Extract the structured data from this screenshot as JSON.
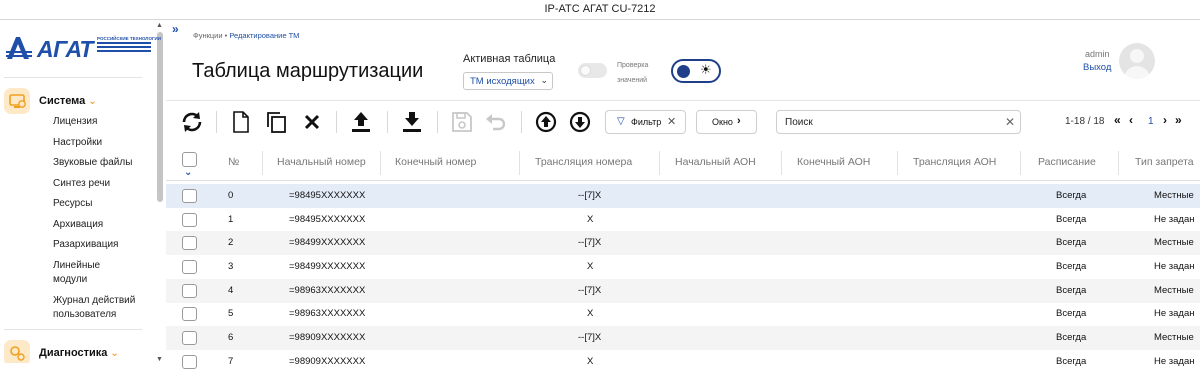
{
  "app_title": "IP-АТС АГАТ CU-7212",
  "logo": {
    "word": "АГАТ",
    "sub": "РОССИЙСКИЕ ТЕХНОЛОГИИ"
  },
  "sidebar": {
    "sections": [
      {
        "title": "Система",
        "items": [
          "Лицензия",
          "Настройки",
          "Звуковые файлы",
          "Синтез речи",
          "Ресурсы",
          "Архивация",
          "Разархивация",
          "Линейные модули",
          "Журнал действий пользователя"
        ]
      },
      {
        "title": "Диагностика",
        "items": []
      }
    ]
  },
  "breadcrumb": {
    "parent": "Функции",
    "current": "Редактирование ТМ"
  },
  "page_title": "Таблица маршрутизации",
  "active_table": {
    "label": "Активная таблица",
    "value": "ТМ исходящих"
  },
  "value_check": {
    "label_line1": "Проверка",
    "label_line2": "значений",
    "enabled": false
  },
  "user": {
    "name": "admin",
    "logout": "Выход"
  },
  "toolbar": {
    "icons": [
      "refresh-icon",
      "new-file-icon",
      "copy-icon",
      "delete-icon",
      "upload-icon",
      "download-icon",
      "save-icon",
      "undo-icon",
      "move-up-icon",
      "move-down-icon"
    ],
    "filter_label": "Фильтр",
    "window_label": "Окно",
    "search_placeholder": "Поиск"
  },
  "pager": {
    "range": "1-18 / 18",
    "page": "1"
  },
  "table": {
    "columns": [
      "№",
      "Начальный номер",
      "Конечный номер",
      "Трансляция номера",
      "Начальный АОН",
      "Конечный АОН",
      "Трансляция АОН",
      "Расписание",
      "Тип запрета"
    ],
    "rows": [
      {
        "n": "0",
        "start": "=98495XXXXXXX",
        "end": "",
        "trans": "--[7]X",
        "aon_start": "",
        "aon_end": "",
        "aon_trans": "",
        "schedule": "Всегда",
        "ban": "Местные"
      },
      {
        "n": "1",
        "start": "=98495XXXXXXX",
        "end": "",
        "trans": "X",
        "aon_start": "",
        "aon_end": "",
        "aon_trans": "",
        "schedule": "Всегда",
        "ban": "Не задан"
      },
      {
        "n": "2",
        "start": "=98499XXXXXXX",
        "end": "",
        "trans": "--[7]X",
        "aon_start": "",
        "aon_end": "",
        "aon_trans": "",
        "schedule": "Всегда",
        "ban": "Местные"
      },
      {
        "n": "3",
        "start": "=98499XXXXXXX",
        "end": "",
        "trans": "X",
        "aon_start": "",
        "aon_end": "",
        "aon_trans": "",
        "schedule": "Всегда",
        "ban": "Не задан"
      },
      {
        "n": "4",
        "start": "=98963XXXXXXX",
        "end": "",
        "trans": "--[7]X",
        "aon_start": "",
        "aon_end": "",
        "aon_trans": "",
        "schedule": "Всегда",
        "ban": "Местные"
      },
      {
        "n": "5",
        "start": "=98963XXXXXXX",
        "end": "",
        "trans": "X",
        "aon_start": "",
        "aon_end": "",
        "aon_trans": "",
        "schedule": "Всегда",
        "ban": "Не задан"
      },
      {
        "n": "6",
        "start": "=98909XXXXXXX",
        "end": "",
        "trans": "--[7]X",
        "aon_start": "",
        "aon_end": "",
        "aon_trans": "",
        "schedule": "Всегда",
        "ban": "Местные"
      },
      {
        "n": "7",
        "start": "=98909XXXXXXX",
        "end": "",
        "trans": "X",
        "aon_start": "",
        "aon_end": "",
        "aon_trans": "",
        "schedule": "Всегда",
        "ban": "Не задан"
      }
    ]
  },
  "colors": {
    "accent": "#1f4fa8",
    "selected_row": "#e4ecf8",
    "alt_row": "#f4f4f4",
    "section_icon_bg": "#fde9c8"
  }
}
